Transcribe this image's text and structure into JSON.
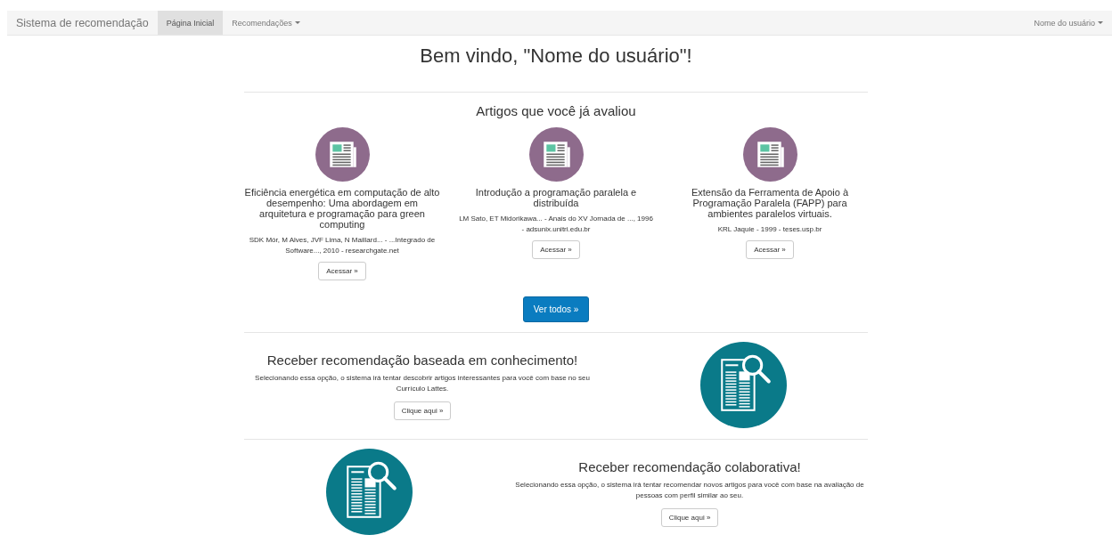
{
  "navbar": {
    "brand": "Sistema de recomendação",
    "items": [
      {
        "label": "Página Inicial",
        "selected": true,
        "dropdown": false
      },
      {
        "label": "Recomendações",
        "selected": false,
        "dropdown": true
      }
    ],
    "user": {
      "label": "Nome do usuário",
      "dropdown": true
    }
  },
  "welcome": "Bem vindo, \"Nome do usuário\"!",
  "rated": {
    "heading": "Artigos que você já avaliou",
    "articles": [
      {
        "title": "Eficiência energética em computação de alto desempenho: Uma abordagem em arquitetura e programação para green computing",
        "meta": "SDK Mór, M Alves, JVF Lima, N Maillard... - ...Integrado de Software..., 2010 - researchgate.net",
        "button": "Acessar »"
      },
      {
        "title": "Introdução a programação paralela e distribuída",
        "meta": "LM Sato, ET Midorikawa... - Anais do XV Jornada de ..., 1996 - adsunix.unitri.edu.br",
        "button": "Acessar »"
      },
      {
        "title": "Extensão da Ferramenta de Apoio à Programação Paralela (FAPP) para ambientes paralelos virtuais.",
        "meta": "KRL Jaquie - 1999 - teses.usp.br",
        "button": "Acessar »"
      }
    ],
    "more": "Ver todos »"
  },
  "options": [
    {
      "heading": "Receber recomendação baseada em conhecimento!",
      "text": "Selecionando essa opção, o sistema irá tentar descobrir artigos interessantes para você com base no seu Currículo Lattes.",
      "button": "Clique aqui »",
      "kind": "right"
    },
    {
      "heading": "Receber recomendação colaborativa!",
      "text": "Selecionando essa opção, o sistema irá tentar recomendar novos artigos para você com base na avaliação de pessoas com perfil similar ao seu.",
      "button": "Clique aqui »",
      "kind": "left"
    }
  ]
}
